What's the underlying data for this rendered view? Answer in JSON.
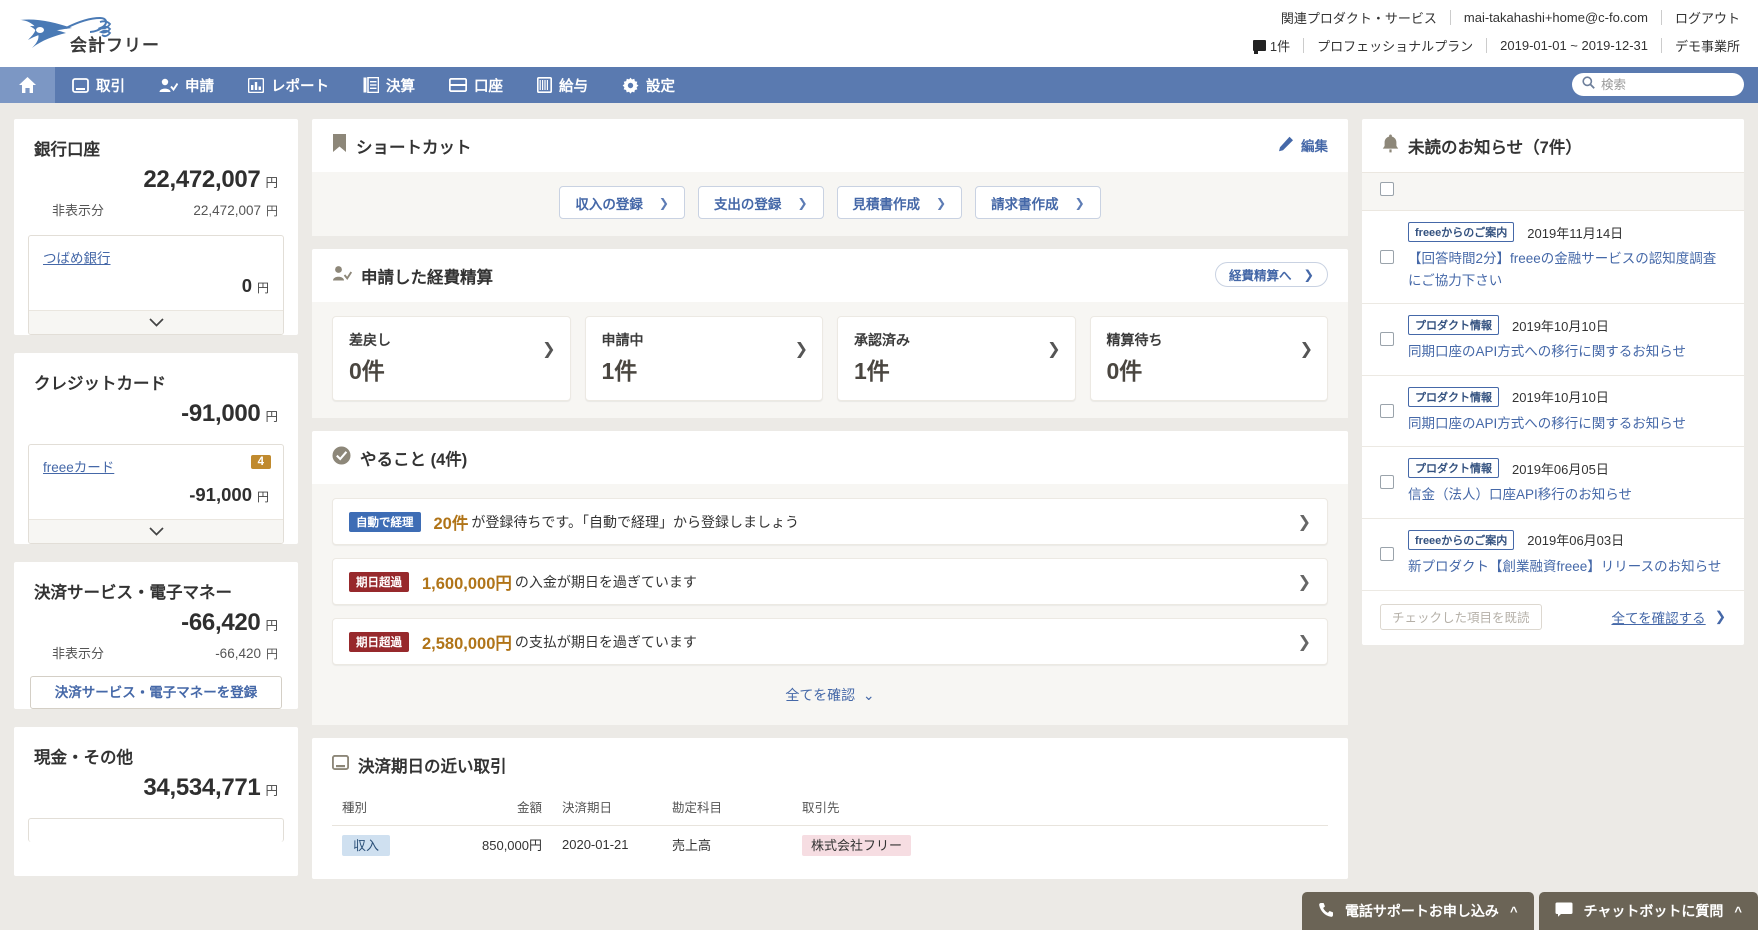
{
  "header": {
    "logo_text": "会計フリー",
    "links": [
      "関連プロダクト・サービス",
      "mai-takahashi+home@c-fo.com",
      "ログアウト"
    ],
    "notice_count": "1件",
    "plan": "プロフェッショナルプラン",
    "period": "2019-01-01 ~ 2019-12-31",
    "office": "デモ事業所"
  },
  "nav": {
    "items": [
      {
        "label": "取引",
        "icon": "transaction-icon"
      },
      {
        "label": "申請",
        "icon": "person-check-icon"
      },
      {
        "label": "レポート",
        "icon": "bar-chart-icon"
      },
      {
        "label": "決算",
        "icon": "book-icon"
      },
      {
        "label": "口座",
        "icon": "wallet-icon"
      },
      {
        "label": "給与",
        "icon": "payroll-icon"
      },
      {
        "label": "設定",
        "icon": "gear-icon"
      }
    ],
    "search_placeholder": "検索"
  },
  "accounts": [
    {
      "title": "銀行口座",
      "total": "22,472,007",
      "yen": "円",
      "hidden_label": "非表示分",
      "hidden_value": "22,472,007",
      "hidden_yen": "円",
      "item": {
        "name": "つばめ銀行",
        "amount": "0",
        "yen": "円",
        "badge": ""
      }
    },
    {
      "title": "クレジットカード",
      "total": "-91,000",
      "yen": "円",
      "item": {
        "name": "freeeカード",
        "amount": "-91,000",
        "yen": "円",
        "badge": "4"
      }
    },
    {
      "title": "決済サービス・電子マネー",
      "total": "-66,420",
      "yen": "円",
      "hidden_label": "非表示分",
      "hidden_value": "-66,420",
      "hidden_yen": "円",
      "register_button": "決済サービス・電子マネーを登録"
    },
    {
      "title": "現金・その他",
      "total": "34,534,771",
      "yen": "円"
    }
  ],
  "shortcuts": {
    "title": "ショートカット",
    "edit_label": "編集",
    "buttons": [
      "収入の登録",
      "支出の登録",
      "見積書作成",
      "請求書作成"
    ]
  },
  "expenses": {
    "title": "申請した経費精算",
    "action_label": "経費精算へ",
    "cards": [
      {
        "label": "差戻し",
        "count": "0件"
      },
      {
        "label": "申請中",
        "count": "1件"
      },
      {
        "label": "承認済み",
        "count": "1件"
      },
      {
        "label": "精算待ち",
        "count": "0件"
      }
    ]
  },
  "todo": {
    "title": "やること (4件)",
    "items": [
      {
        "tag": "自動で経理",
        "tag_color": "blue",
        "amount": "20件",
        "text": "が登録待ちです。「自動で経理」から登録しましょう"
      },
      {
        "tag": "期日超過",
        "tag_color": "red",
        "amount": "1,600,000円",
        "text": "の入金が期日を過ぎています"
      },
      {
        "tag": "期日超過",
        "tag_color": "red",
        "amount": "2,580,000円",
        "text": "の支払が期日を過ぎています"
      }
    ],
    "all_label": "全てを確認"
  },
  "transactions": {
    "title": "決済期日の近い取引",
    "columns": [
      "種別",
      "金額",
      "決済期日",
      "勘定科目",
      "取引先"
    ],
    "rows": [
      {
        "type": "収入",
        "amount": "850,000円",
        "due": "2020-01-21",
        "account": "売上高",
        "partner": "株式会社フリー"
      }
    ]
  },
  "notifications": {
    "title": "未読のお知らせ（7件）",
    "items": [
      {
        "tag": "freeeからのご案内",
        "date": "2019年11月14日",
        "title": "【回答時間2分】freeeの金融サービスの認知度調査にご協力下さい"
      },
      {
        "tag": "プロダクト情報",
        "date": "2019年10月10日",
        "title": "同期口座のAPI方式への移行に関するお知らせ"
      },
      {
        "tag": "プロダクト情報",
        "date": "2019年10月10日",
        "title": "同期口座のAPI方式への移行に関するお知らせ"
      },
      {
        "tag": "プロダクト情報",
        "date": "2019年06月05日",
        "title": "信金（法人）口座API移行のお知らせ"
      },
      {
        "tag": "freeeからのご案内",
        "date": "2019年06月03日",
        "title": "新プロダクト【創業融資freee】リリースのお知らせ"
      }
    ],
    "mark_read_label": "チェックした項目を既読",
    "confirm_all_label": "全てを確認する"
  },
  "floats": [
    {
      "label": "電話サポートお申し込み",
      "icon": "phone-icon"
    },
    {
      "label": "チャットボットに質問",
      "icon": "chat-icon"
    }
  ]
}
